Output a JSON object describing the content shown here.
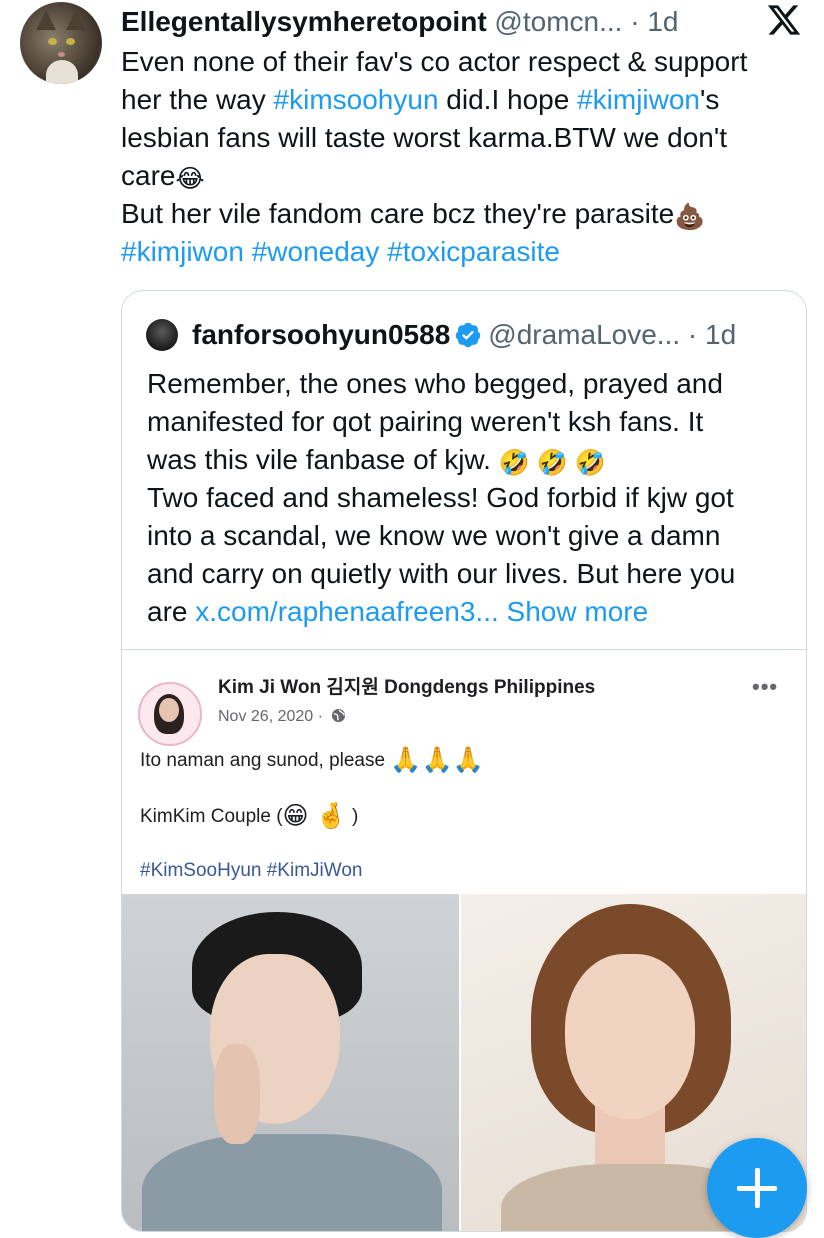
{
  "tweet": {
    "display_name": "Ellegentallysymheretopoint",
    "handle": "@tomcn...",
    "separator": " · ",
    "time": "1d",
    "line1": "Even none of their fav's co actor respect & support",
    "line2_a": "her the way ",
    "line2_tag1": "#kimsoohyun",
    "line2_b": " did.I hope ",
    "line2_tag2": "#kimjiwon",
    "line2_c": "'s",
    "line3": "lesbian fans will taste worst karma.BTW we don't",
    "line4": "care",
    "line4_emoji": "😂",
    "line5": "But her vile fandom care bcz they're parasite",
    "line5_emoji": "💩",
    "hashtags": [
      "#kimjiwon",
      "#woneday",
      "#toxicparasite"
    ]
  },
  "quote": {
    "display_name": "fanforsoohyun0588",
    "handle": "@dramaLove...",
    "separator": " · ",
    "time": "1d",
    "line1": "Remember, the ones who begged, prayed and",
    "line2": "manifested for qot pairing weren't ksh fans. It",
    "line3": "was this vile fanbase of kjw. ",
    "line3_emoji": "🤣 🤣 🤣",
    "line4": "Two faced and shameless! God forbid if kjw got",
    "line5": "into a scandal, we know we won't give a damn",
    "line6": "and carry on quietly with our lives. But here you",
    "line7_a": "are ",
    "line7_link": "x.com/raphenaafreen3...",
    "line7_more": " Show more"
  },
  "fb_post": {
    "page_name": "Kim Ji Won 김지원 Dongdengs Philippines",
    "date": "Nov 26, 2020 · ",
    "more": "•••",
    "text1": "Ito naman ang sunod, please ",
    "text1_emoji": "🙏🙏🙏",
    "text2_a": "KimKim Couple (",
    "text2_emoji": "😁 🤞",
    "text2_b": " )",
    "hashtags": "#KimSooHyun #KimJiWon"
  },
  "colors": {
    "link_blue": "#1d9bf0",
    "text_primary": "#0f1419",
    "text_secondary": "#536471"
  }
}
